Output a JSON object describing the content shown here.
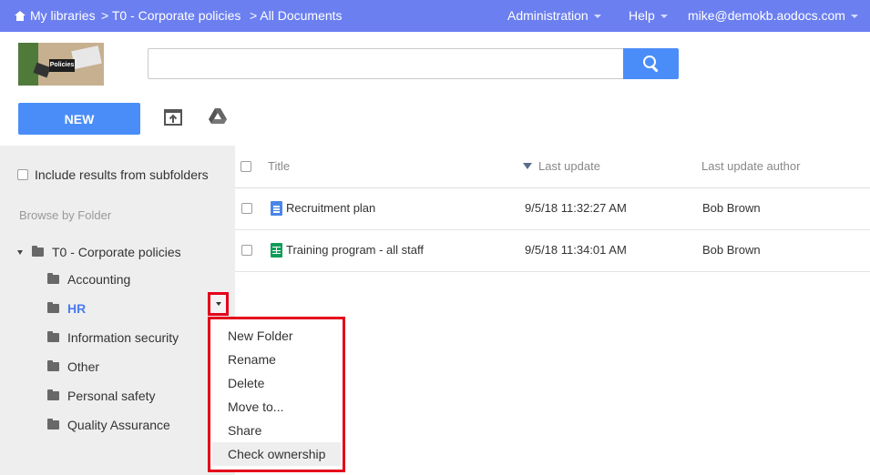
{
  "topbar": {
    "breadcrumb": [
      {
        "label": "My libraries",
        "icon": "home-icon"
      },
      {
        "label": "> T0 - Corporate policies"
      },
      {
        "label": "> All Documents"
      }
    ],
    "menus": [
      {
        "label": "Administration"
      },
      {
        "label": "Help"
      },
      {
        "label": "mike@demokb.aodocs.com"
      }
    ],
    "bar_color": "#6b7ff0"
  },
  "header": {
    "logo_text": "Policies",
    "search": {
      "value": "",
      "placeholder": ""
    },
    "search_button_icon": "search-icon"
  },
  "toolbar": {
    "new_label": "NEW",
    "upload_icon": "upload-icon",
    "drive_icon": "google-drive-icon",
    "accent_color": "#4b8df8"
  },
  "sidebar": {
    "include_subfolders_label": "Include results from subfolders",
    "browse_label": "Browse by Folder",
    "root": "T0 - Corporate policies",
    "folders": [
      {
        "label": "Accounting",
        "selected": false
      },
      {
        "label": "HR",
        "selected": true
      },
      {
        "label": "Information security",
        "selected": false
      },
      {
        "label": "Other",
        "selected": false
      },
      {
        "label": "Personal safety",
        "selected": false
      },
      {
        "label": "Quality Assurance",
        "selected": false
      }
    ]
  },
  "context_menu": {
    "items": [
      "New Folder",
      "Rename",
      "Delete",
      "Move to...",
      "Share",
      "Check ownership"
    ],
    "hovered": "Check ownership",
    "highlight_color": "#e4001b"
  },
  "table": {
    "columns": [
      "Title",
      "Last update",
      "Last update author"
    ],
    "sort_column": "Last update",
    "rows": [
      {
        "type": "doc",
        "title": "Recruitment plan",
        "updated": "9/5/18 11:32:27 AM",
        "author": "Bob Brown"
      },
      {
        "type": "sheet",
        "title": "Training program - all staff",
        "updated": "9/5/18 11:34:01 AM",
        "author": "Bob Brown"
      }
    ]
  }
}
